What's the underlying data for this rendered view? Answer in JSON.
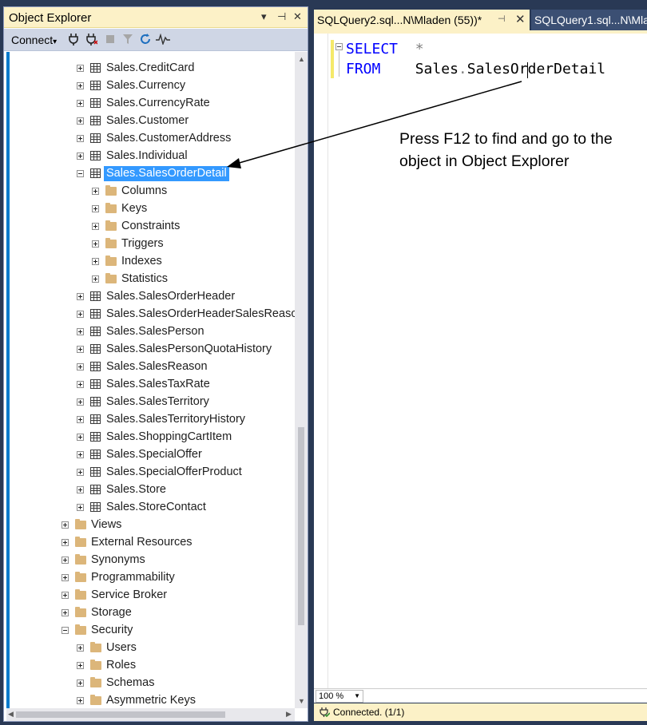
{
  "object_explorer": {
    "title": "Object Explorer",
    "title_buttons": {
      "dropdown": "▾",
      "pin": "⊣",
      "close": "✕"
    },
    "toolbar": {
      "connect_label": "Connect",
      "connect_arrow": "▾"
    },
    "tree": [
      {
        "label": "Sales.CreditCard",
        "type": "table",
        "level": 2,
        "expander": "plus"
      },
      {
        "label": "Sales.Currency",
        "type": "table",
        "level": 2,
        "expander": "plus"
      },
      {
        "label": "Sales.CurrencyRate",
        "type": "table",
        "level": 2,
        "expander": "plus"
      },
      {
        "label": "Sales.Customer",
        "type": "table",
        "level": 2,
        "expander": "plus"
      },
      {
        "label": "Sales.CustomerAddress",
        "type": "table",
        "level": 2,
        "expander": "plus"
      },
      {
        "label": "Sales.Individual",
        "type": "table",
        "level": 2,
        "expander": "plus"
      },
      {
        "label": "Sales.SalesOrderDetail",
        "type": "table",
        "level": 2,
        "expander": "minus",
        "selected": true
      },
      {
        "label": "Columns",
        "type": "folder",
        "level": 3,
        "expander": "plus"
      },
      {
        "label": "Keys",
        "type": "folder",
        "level": 3,
        "expander": "plus"
      },
      {
        "label": "Constraints",
        "type": "folder",
        "level": 3,
        "expander": "plus"
      },
      {
        "label": "Triggers",
        "type": "folder",
        "level": 3,
        "expander": "plus"
      },
      {
        "label": "Indexes",
        "type": "folder",
        "level": 3,
        "expander": "plus"
      },
      {
        "label": "Statistics",
        "type": "folder",
        "level": 3,
        "expander": "plus"
      },
      {
        "label": "Sales.SalesOrderHeader",
        "type": "table",
        "level": 2,
        "expander": "plus"
      },
      {
        "label": "Sales.SalesOrderHeaderSalesReason",
        "type": "table",
        "level": 2,
        "expander": "plus"
      },
      {
        "label": "Sales.SalesPerson",
        "type": "table",
        "level": 2,
        "expander": "plus"
      },
      {
        "label": "Sales.SalesPersonQuotaHistory",
        "type": "table",
        "level": 2,
        "expander": "plus"
      },
      {
        "label": "Sales.SalesReason",
        "type": "table",
        "level": 2,
        "expander": "plus"
      },
      {
        "label": "Sales.SalesTaxRate",
        "type": "table",
        "level": 2,
        "expander": "plus"
      },
      {
        "label": "Sales.SalesTerritory",
        "type": "table",
        "level": 2,
        "expander": "plus"
      },
      {
        "label": "Sales.SalesTerritoryHistory",
        "type": "table",
        "level": 2,
        "expander": "plus"
      },
      {
        "label": "Sales.ShoppingCartItem",
        "type": "table",
        "level": 2,
        "expander": "plus"
      },
      {
        "label": "Sales.SpecialOffer",
        "type": "table",
        "level": 2,
        "expander": "plus"
      },
      {
        "label": "Sales.SpecialOfferProduct",
        "type": "table",
        "level": 2,
        "expander": "plus"
      },
      {
        "label": "Sales.Store",
        "type": "table",
        "level": 2,
        "expander": "plus"
      },
      {
        "label": "Sales.StoreContact",
        "type": "table",
        "level": 2,
        "expander": "plus"
      },
      {
        "label": "Views",
        "type": "folder",
        "level": 1,
        "expander": "plus"
      },
      {
        "label": "External Resources",
        "type": "folder",
        "level": 1,
        "expander": "plus"
      },
      {
        "label": "Synonyms",
        "type": "folder",
        "level": 1,
        "expander": "plus"
      },
      {
        "label": "Programmability",
        "type": "folder",
        "level": 1,
        "expander": "plus"
      },
      {
        "label": "Service Broker",
        "type": "folder",
        "level": 1,
        "expander": "plus"
      },
      {
        "label": "Storage",
        "type": "folder",
        "level": 1,
        "expander": "plus"
      },
      {
        "label": "Security",
        "type": "folder",
        "level": 1,
        "expander": "minus"
      },
      {
        "label": "Users",
        "type": "folder",
        "level": 2,
        "expander": "plus"
      },
      {
        "label": "Roles",
        "type": "folder",
        "level": 2,
        "expander": "plus"
      },
      {
        "label": "Schemas",
        "type": "folder",
        "level": 2,
        "expander": "plus"
      },
      {
        "label": "Asymmetric Keys",
        "type": "folder",
        "level": 2,
        "expander": "plus"
      }
    ]
  },
  "editor": {
    "tabs": [
      {
        "label": "SQLQuery2.sql...N\\Mladen (55))*",
        "active": true,
        "pin": "⊣",
        "close": "✕"
      },
      {
        "label": "SQLQuery1.sql...N\\Mla",
        "active": false
      }
    ],
    "code": {
      "line1_kw": "SELECT",
      "line1_rest": "*",
      "line2_kw": "FROM",
      "line2_schema": "Sales",
      "line2_dot": ".",
      "line2_obj": "SalesOrderDetail"
    },
    "annotation": "Press F12 to find and go to the object in Object Explorer",
    "zoom": "100 %",
    "status": "Connected. (1/1)"
  },
  "colors": {
    "accent": "#007acc",
    "selection": "#3399ff",
    "keyword": "#0000ff",
    "tab_active": "#fcf1c7",
    "frame": "#293955"
  }
}
